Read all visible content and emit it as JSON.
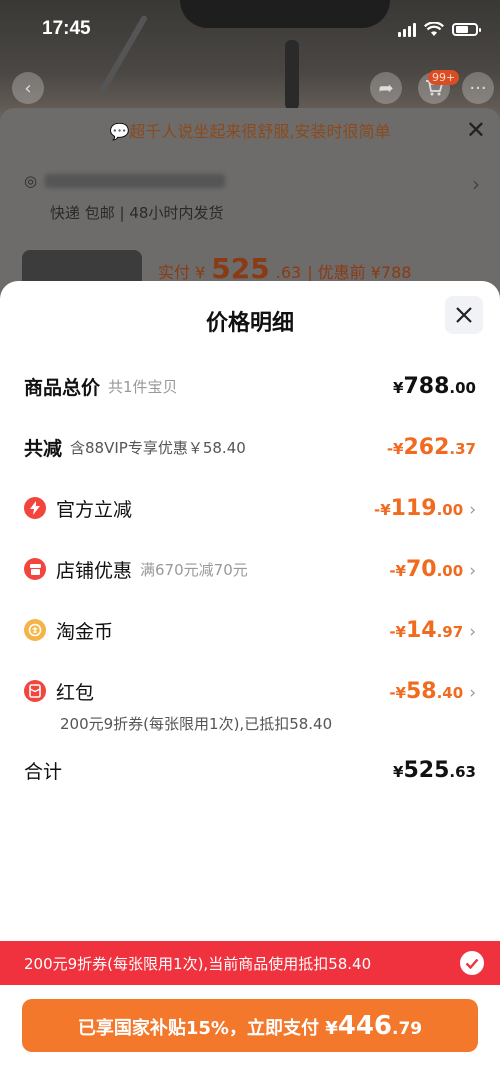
{
  "status_bar": {
    "time": "17:45"
  },
  "background": {
    "cart_badge": "99+",
    "tip": "超千人说坐起来很舒服,安装时很简单",
    "shipping": "快递 包邮 | 48小时内发货",
    "price_label": "实付 ¥",
    "price_int": "525",
    "price_dec": ".63",
    "original_label": "| 优惠前 ¥788"
  },
  "modal": {
    "title": "价格明细",
    "rows": [
      {
        "label": "商品总价",
        "sub": "共1件宝贝",
        "currency": "¥",
        "int": "788",
        "dec": ".00",
        "icon": ""
      },
      {
        "label": "共减",
        "sub": "含88VIP专享优惠￥58.40",
        "currency": "-¥",
        "int": "262",
        "dec": ".37",
        "icon": ""
      },
      {
        "label": "官方立减",
        "sub": "",
        "currency": "-¥",
        "int": "119",
        "dec": ".00",
        "icon": "lightning-icon"
      },
      {
        "label": "店铺优惠",
        "sub": "满670元减70元",
        "currency": "-¥",
        "int": "70",
        "dec": ".00",
        "icon": "shop-icon"
      },
      {
        "label": "淘金币",
        "sub": "",
        "currency": "-¥",
        "int": "14",
        "dec": ".97",
        "icon": "gold-coin-icon"
      },
      {
        "label": "红包",
        "sub": "",
        "currency": "-¥",
        "int": "58",
        "dec": ".40",
        "icon": "red-packet-icon"
      },
      {
        "label": "合计",
        "sub": "",
        "currency": "¥",
        "int": "525",
        "dec": ".63",
        "icon": ""
      }
    ],
    "coupon_note": "200元9折券(每张限用1次),已抵扣58.40"
  },
  "bottom": {
    "coupon_bar": "200元9折券(每张限用1次),当前商品使用抵扣58.40",
    "pay_label": "已享国家补贴15%，立即支付 ¥",
    "pay_int": "446",
    "pay_dec": ".79"
  },
  "colors": {
    "accent_orange": "#f06a1f",
    "coupon_red": "#f0323e",
    "pay_orange": "#f3782c"
  }
}
